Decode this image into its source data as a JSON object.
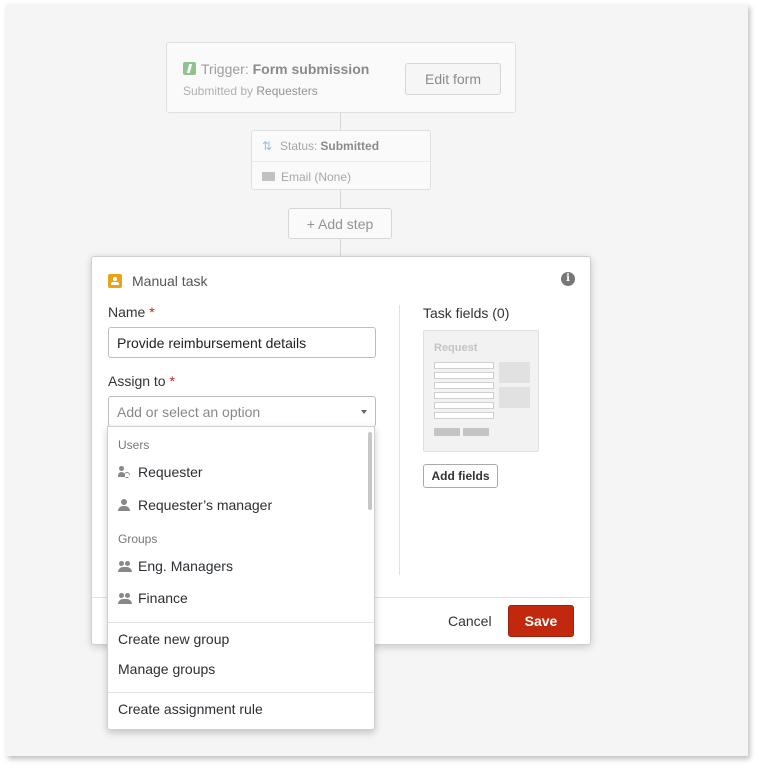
{
  "trigger": {
    "label": "Trigger:",
    "name": "Form submission",
    "sub_prefix": "Submitted by",
    "sub_value": "Requesters",
    "edit_label": "Edit form"
  },
  "status_step": {
    "status_label": "Status:",
    "status_value": "Submitted",
    "email_label": "Email (None)"
  },
  "add_step_label": "+ Add step",
  "modal": {
    "title": "Manual task",
    "info": "i",
    "name_label": "Name",
    "name_value": "Provide reimbursement details",
    "assign_label": "Assign to",
    "assign_placeholder": "Add or select an option",
    "required_mark": "*",
    "task_fields_label": "Task fields (0)",
    "preview_title": "Request",
    "add_fields_label": "Add fields",
    "cancel_label": "Cancel",
    "save_label": "Save"
  },
  "dropdown": {
    "users_header": "Users",
    "users": [
      "Requester",
      "Requester’s manager"
    ],
    "groups_header": "Groups",
    "groups": [
      "Eng. Managers",
      "Finance"
    ],
    "actions": [
      "Create new group",
      "Manage groups"
    ],
    "rule_action": "Create assignment rule"
  },
  "colors": {
    "save_button": "#c1280e",
    "required": "#c5221f",
    "task_icon": "#e8a317",
    "trigger_icon": "#3d9a3d"
  }
}
